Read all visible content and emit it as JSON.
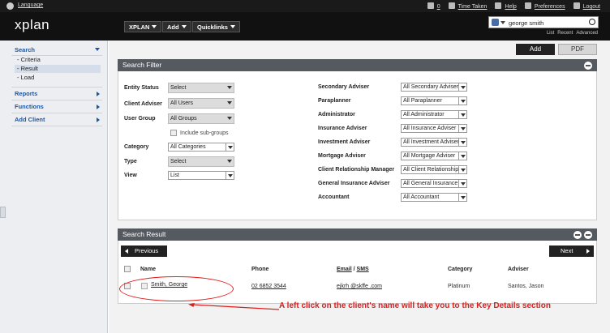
{
  "topbar": {
    "language": "Language",
    "mail_count": "0",
    "time_taken": "Time Taken",
    "help": "Help",
    "preferences": "Preferences",
    "logout": "Logout"
  },
  "header": {
    "logo": "xplan",
    "nav": [
      {
        "label": "XPLAN"
      },
      {
        "label": "Add"
      },
      {
        "label": "Quicklinks"
      }
    ],
    "search_value": "george smith",
    "search_links": [
      "List",
      "Recent",
      "Advanced"
    ]
  },
  "sidebar": {
    "search": "Search",
    "criteria": "- Criteria",
    "result": "- Result",
    "load": "- Load",
    "reports": "Reports",
    "functions": "Functions",
    "add_client": "Add Client"
  },
  "actions": {
    "add": "Add",
    "pdf": "PDF"
  },
  "filter": {
    "title": "Search Filter",
    "left": [
      {
        "label": "Entity Status",
        "value": "Select"
      },
      {
        "label": "Client Adviser",
        "value": "All Users"
      },
      {
        "label": "User Group",
        "value": "All Groups"
      },
      {
        "label": "Category",
        "value": "All Categories"
      },
      {
        "label": "Type",
        "value": "Select"
      },
      {
        "label": "View",
        "value": "List"
      }
    ],
    "include_subgroups": "Include sub-groups",
    "right": [
      {
        "label": "Secondary Adviser",
        "value": "All Secondary Adviser"
      },
      {
        "label": "Paraplanner",
        "value": "All Paraplanner"
      },
      {
        "label": "Administrator",
        "value": "All Administrator"
      },
      {
        "label": "Insurance Adviser",
        "value": "All Insurance Adviser"
      },
      {
        "label": "Investment Adviser",
        "value": "All Investment Adviser"
      },
      {
        "label": "Mortgage Adviser",
        "value": "All Mortgage Adviser"
      },
      {
        "label": "Client Relationship Manager",
        "value": "All Client Relationship"
      },
      {
        "label": "General Insurance Adviser",
        "value": "All General Insurance"
      },
      {
        "label": "Accountant",
        "value": "All Accountant"
      }
    ]
  },
  "result": {
    "title": "Search Result",
    "previous": "Previous",
    "next": "Next",
    "columns": {
      "name": "Name",
      "phone": "Phone",
      "email": "Email",
      "sms": "SMS",
      "category": "Category",
      "adviser": "Adviser"
    },
    "rows": [
      {
        "name": "Smith, George",
        "phone": "02 6852 3544",
        "email": "ejkrh @skffe .com",
        "category": "Platinum",
        "adviser": "Santos, Jason"
      }
    ]
  },
  "annotation": "A left click on the client's name will take you to the Key Details section"
}
